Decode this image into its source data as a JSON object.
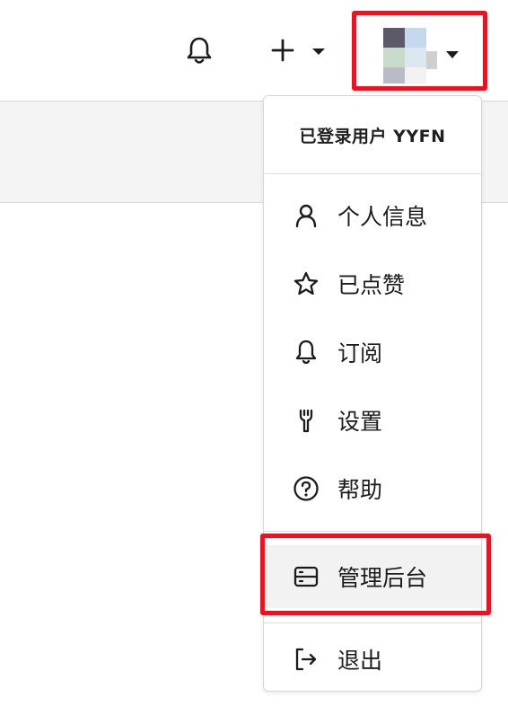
{
  "header": {
    "notifications_icon": "bell-icon",
    "create_icon": "plus-icon",
    "create_caret_icon": "caret-down-icon",
    "avatar_caret_icon": "caret-down-icon"
  },
  "user_menu": {
    "signed_in_label": "已登录用户 YYFN",
    "items": [
      {
        "label": "个人信息",
        "icon": "user-icon"
      },
      {
        "label": "已点赞",
        "icon": "star-icon"
      },
      {
        "label": "订阅",
        "icon": "bell-icon"
      },
      {
        "label": "设置",
        "icon": "wrench-icon"
      },
      {
        "label": "帮助",
        "icon": "help-circle-icon"
      },
      {
        "label": "管理后台",
        "icon": "server-icon"
      },
      {
        "label": "退出",
        "icon": "sign-out-icon"
      }
    ]
  },
  "colors": {
    "highlight": "#ff0a1a",
    "text": "#1c1c1c",
    "hover_bg": "#f2f2f2"
  }
}
